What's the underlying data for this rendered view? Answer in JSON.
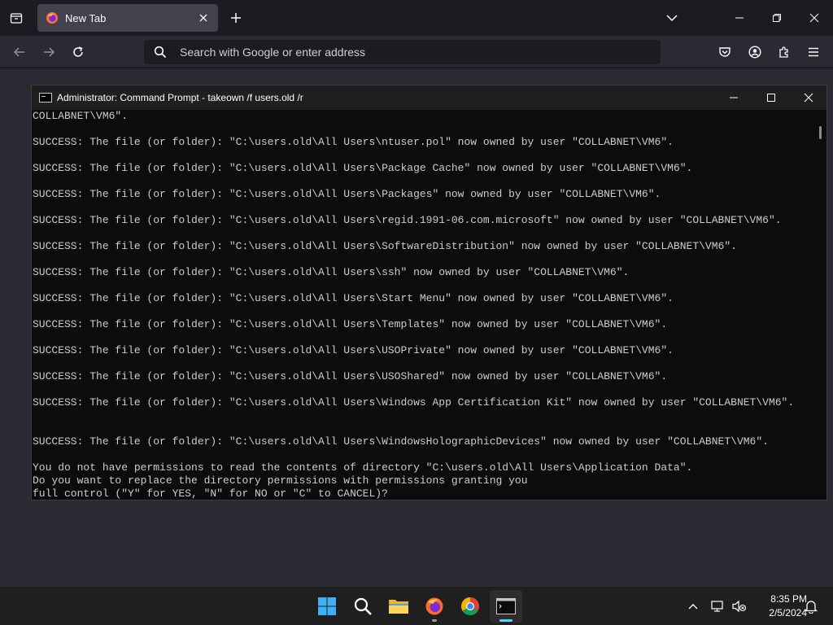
{
  "browser": {
    "tab": {
      "title": "New Tab"
    },
    "urlbar": {
      "placeholder": "Search with Google or enter address"
    }
  },
  "cmd": {
    "title": "Administrator: Command Prompt - takeown  /f users.old /r",
    "lines": [
      "COLLABNET\\VM6\".",
      "",
      "SUCCESS: The file (or folder): \"C:\\users.old\\All Users\\ntuser.pol\" now owned by user \"COLLABNET\\VM6\".",
      "",
      "SUCCESS: The file (or folder): \"C:\\users.old\\All Users\\Package Cache\" now owned by user \"COLLABNET\\VM6\".",
      "",
      "SUCCESS: The file (or folder): \"C:\\users.old\\All Users\\Packages\" now owned by user \"COLLABNET\\VM6\".",
      "",
      "SUCCESS: The file (or folder): \"C:\\users.old\\All Users\\regid.1991-06.com.microsoft\" now owned by user \"COLLABNET\\VM6\".",
      "",
      "SUCCESS: The file (or folder): \"C:\\users.old\\All Users\\SoftwareDistribution\" now owned by user \"COLLABNET\\VM6\".",
      "",
      "SUCCESS: The file (or folder): \"C:\\users.old\\All Users\\ssh\" now owned by user \"COLLABNET\\VM6\".",
      "",
      "SUCCESS: The file (or folder): \"C:\\users.old\\All Users\\Start Menu\" now owned by user \"COLLABNET\\VM6\".",
      "",
      "SUCCESS: The file (or folder): \"C:\\users.old\\All Users\\Templates\" now owned by user \"COLLABNET\\VM6\".",
      "",
      "SUCCESS: The file (or folder): \"C:\\users.old\\All Users\\USOPrivate\" now owned by user \"COLLABNET\\VM6\".",
      "",
      "SUCCESS: The file (or folder): \"C:\\users.old\\All Users\\USOShared\" now owned by user \"COLLABNET\\VM6\".",
      "",
      "SUCCESS: The file (or folder): \"C:\\users.old\\All Users\\Windows App Certification Kit\" now owned by user \"COLLABNET\\VM6\".",
      "",
      "",
      "SUCCESS: The file (or folder): \"C:\\users.old\\All Users\\WindowsHolographicDevices\" now owned by user \"COLLABNET\\VM6\".",
      "",
      "You do not have permissions to read the contents of directory \"C:\\users.old\\All Users\\Application Data\".",
      "Do you want to replace the directory permissions with permissions granting you",
      "full control (\"Y\" for YES, \"N\" for NO or \"C\" to CANCEL)?"
    ]
  },
  "taskbar": {
    "apps": [
      "start-icon",
      "search-icon",
      "file-explorer-icon",
      "firefox-icon",
      "chrome-icon",
      "terminal-icon"
    ],
    "clock": {
      "time": "8:35 PM",
      "date": "2/5/2024"
    }
  },
  "colors": {
    "accent": "#60cdff",
    "browser_bg": "#2b2a33",
    "tabbar_bg": "#1c1b22",
    "console_bg": "#0c0c0c",
    "console_text": "#cccccc"
  }
}
